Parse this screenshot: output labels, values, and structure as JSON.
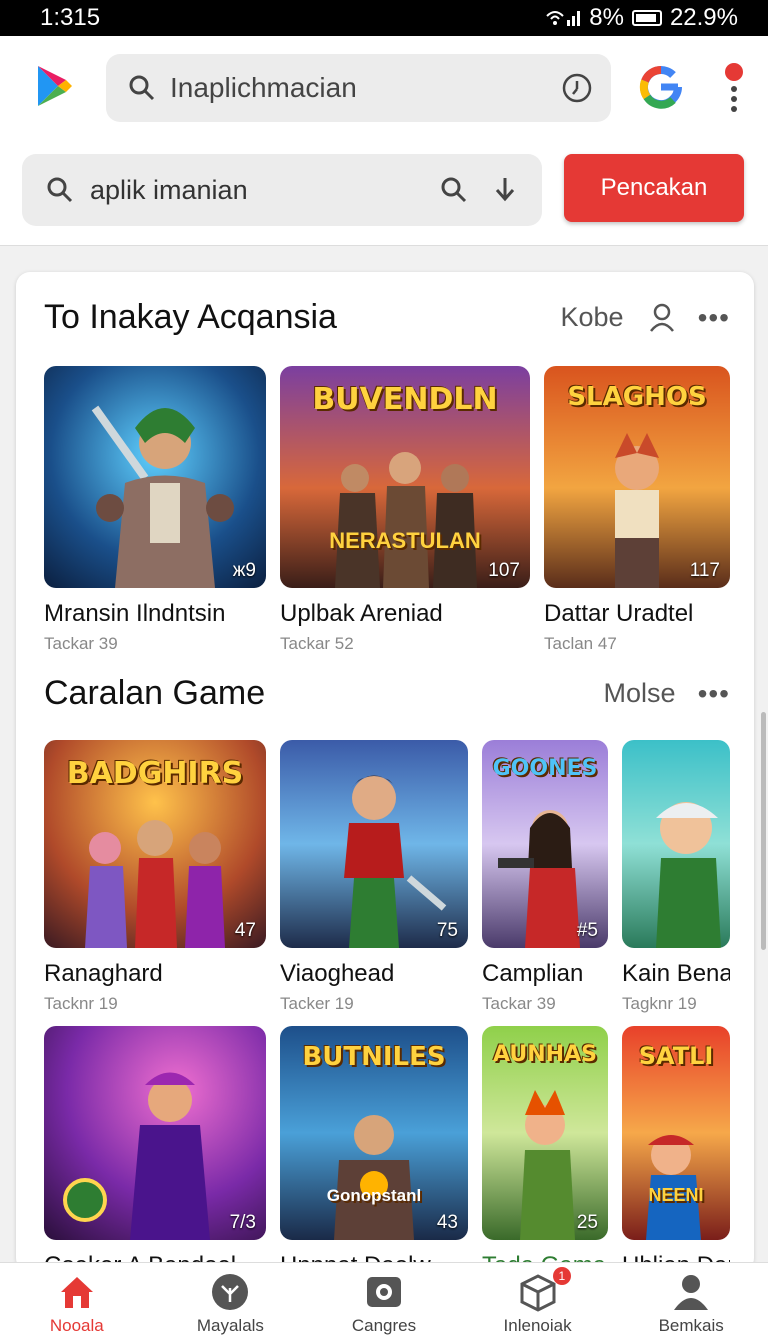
{
  "status": {
    "time": "1:315",
    "battery_pct": "%",
    "right_text": "22.9%"
  },
  "top_search": {
    "value": "Inaplichmacian"
  },
  "secondary_search": {
    "value": "aplik imanian",
    "button_label": "Pencakan"
  },
  "sections": [
    {
      "title": "To Inakay Acqansia",
      "more_label": "Kobe",
      "tiles": [
        {
          "name": "Mransin Ilndntsin",
          "sub": "Tackar 39",
          "badge": "ж9",
          "art_title": "",
          "art_sub": ""
        },
        {
          "name": "Uplbak Areniad",
          "sub": "Tackar 52",
          "badge": "107",
          "art_title": "BUVENDLN",
          "art_sub": "NERASTULAN"
        },
        {
          "name": "Dattar Uradtel",
          "sub": "Taclan 47",
          "badge": "117",
          "art_title": "SLAGHOS",
          "art_sub": ""
        }
      ]
    },
    {
      "title": "Caralan Game",
      "more_label": "Molse",
      "tiles": [
        {
          "name": "Ranaghard",
          "sub": "Tacknr 19",
          "badge": "47",
          "art_title": "BADGHIRS",
          "art_sub": ""
        },
        {
          "name": "Viaoghead",
          "sub": "Tacker 19",
          "badge": "75",
          "art_title": "",
          "art_sub": ""
        },
        {
          "name": "Camplian",
          "sub": "Tackar 39",
          "badge": "#5",
          "art_title": "GOONES",
          "art_sub": ""
        },
        {
          "name": "Kain Bena",
          "sub": "Tagknr 19",
          "badge": "",
          "art_title": "",
          "art_sub": ""
        }
      ]
    },
    {
      "tiles": [
        {
          "name": "Coeker A Bandoel",
          "badge": "7/3",
          "art_title": ""
        },
        {
          "name": "Hnnnat Daolw",
          "badge": "43",
          "art_title": "BUTNILES",
          "art_sub": "Gonopstanl"
        },
        {
          "name": "Tada Gama",
          "badge": "25",
          "art_title": "AUNHAS"
        },
        {
          "name": "Uhlian Darl",
          "badge": "",
          "art_title": "SATLI",
          "art_sub": "NEENI"
        }
      ]
    }
  ],
  "bottom_nav": [
    {
      "label": "Nooala",
      "icon": "home-icon"
    },
    {
      "label": "Mayalals",
      "icon": "leaf-icon"
    },
    {
      "label": "Cangres",
      "icon": "camera-icon"
    },
    {
      "label": "Inlenoiak",
      "icon": "box-icon",
      "badge": "1"
    },
    {
      "label": "Bemkais",
      "icon": "person-icon"
    }
  ],
  "colors": {
    "accent": "#e53935",
    "card_bg": "#ffffff",
    "page_bg": "#f1f1f1"
  }
}
